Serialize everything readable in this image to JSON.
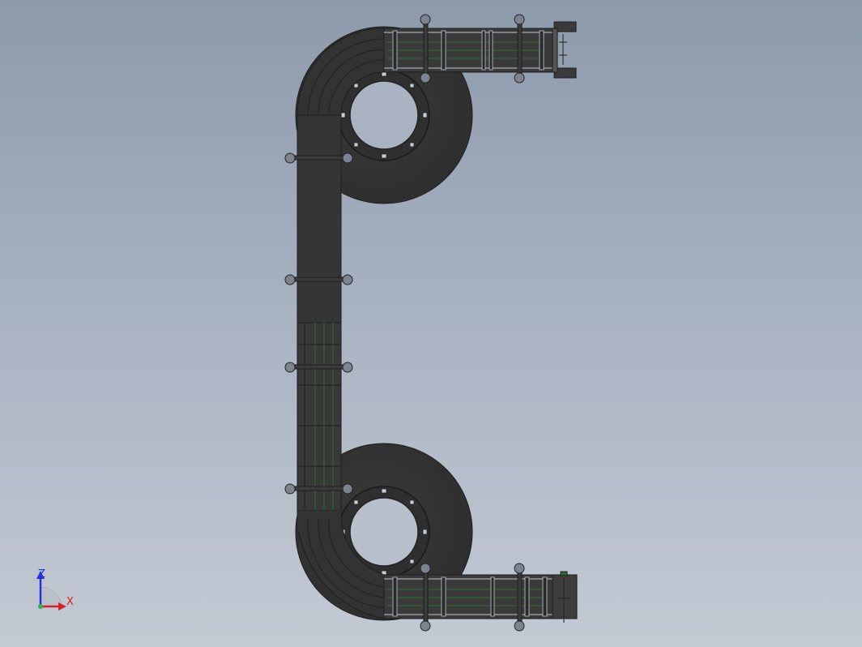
{
  "viewport": {
    "background_top": "#8d9aab",
    "background_bottom": "#c4cad4"
  },
  "model": {
    "body_color": "#3b3b3b",
    "edge_color": "#1e1e1e",
    "rail_color": "#2f6b2f"
  },
  "triad": {
    "z_label": "Z",
    "x_label": "X",
    "z_color": "#1f35d8",
    "x_color": "#d81f1f"
  }
}
